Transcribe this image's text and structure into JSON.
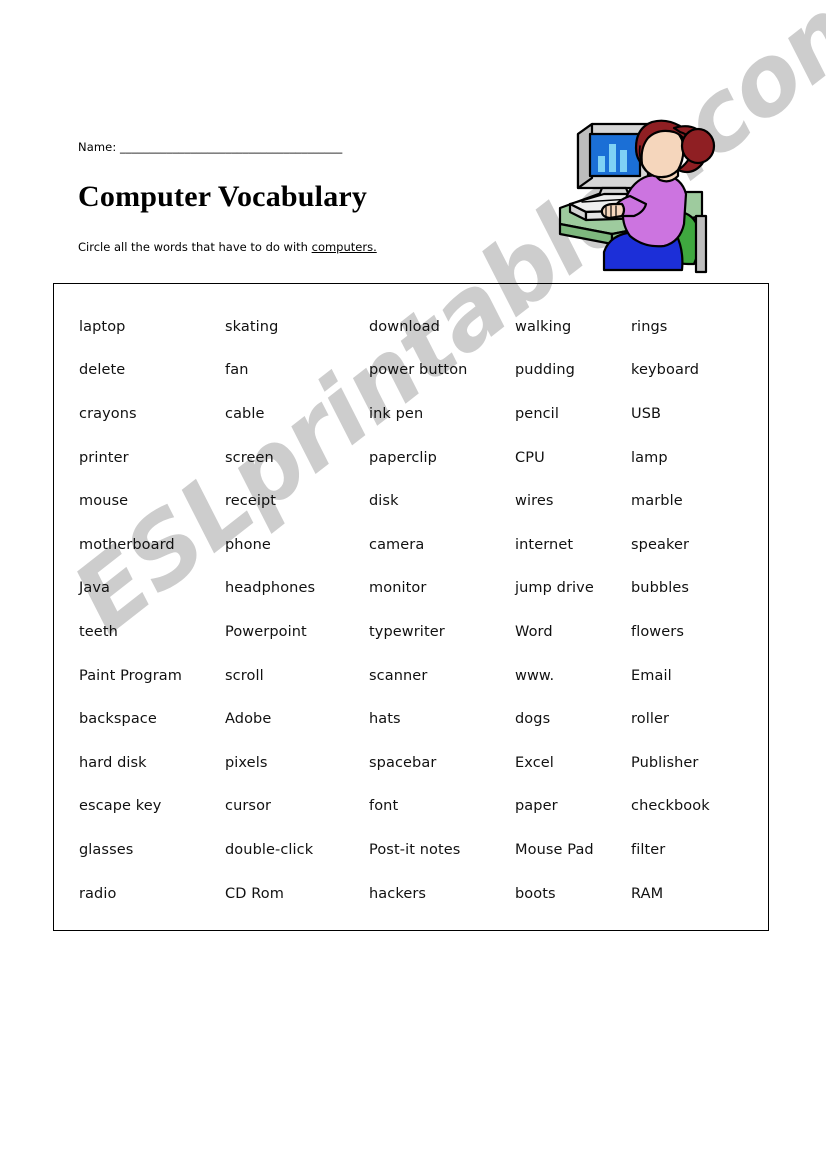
{
  "header": {
    "name_label": "Name: ______________________________________",
    "title": "Computer Vocabulary",
    "instruction_prefix": "Circle all the words that have to do with ",
    "instruction_emphasis": "computers."
  },
  "clipart": {
    "name": "woman-at-computer-clipart",
    "description": "Woman with auburn hair bun seated in a green chair typing at a desktop computer showing a bar chart",
    "colors": {
      "hair": "#8f1f23",
      "skin": "#f5d6bc",
      "shirt": "#cc74e0",
      "skirt": "#1c2fd8",
      "chair": "#3fa83f",
      "desk": "#9ecb9e",
      "monitor_case": "#d6d6d6",
      "screen": "#1b6fd6",
      "screen_bars": "#7fd2f5",
      "outline": "#000000"
    }
  },
  "watermark": {
    "text": "ESLprintables.com",
    "color": "#cdcdcd"
  },
  "wordbox": {
    "columns": 5,
    "rows": 14,
    "words": [
      [
        "laptop",
        "skating",
        "download",
        "walking",
        "rings"
      ],
      [
        "delete",
        "fan",
        "power button",
        "pudding",
        "keyboard"
      ],
      [
        "crayons",
        "cable",
        "ink pen",
        "pencil",
        "USB"
      ],
      [
        "printer",
        "screen",
        "paperclip",
        "CPU",
        "lamp"
      ],
      [
        "mouse",
        "receipt",
        "disk",
        "wires",
        "marble"
      ],
      [
        "motherboard",
        "phone",
        "camera",
        "internet",
        "speaker"
      ],
      [
        "Java",
        "headphones",
        "monitor",
        "jump drive",
        "bubbles"
      ],
      [
        "teeth",
        "Powerpoint",
        "typewriter",
        "Word",
        "flowers"
      ],
      [
        "Paint Program",
        "scroll",
        "scanner",
        "www.",
        "Email"
      ],
      [
        "backspace",
        "Adobe",
        "hats",
        "dogs",
        "roller"
      ],
      [
        "hard disk",
        "pixels",
        "spacebar",
        "Excel",
        "Publisher"
      ],
      [
        "escape key",
        "cursor",
        "font",
        "paper",
        "checkbook"
      ],
      [
        "glasses",
        "double-click",
        "Post-it notes",
        "Mouse Pad",
        "filter"
      ],
      [
        "radio",
        "CD Rom",
        "hackers",
        "boots",
        "RAM"
      ]
    ]
  }
}
